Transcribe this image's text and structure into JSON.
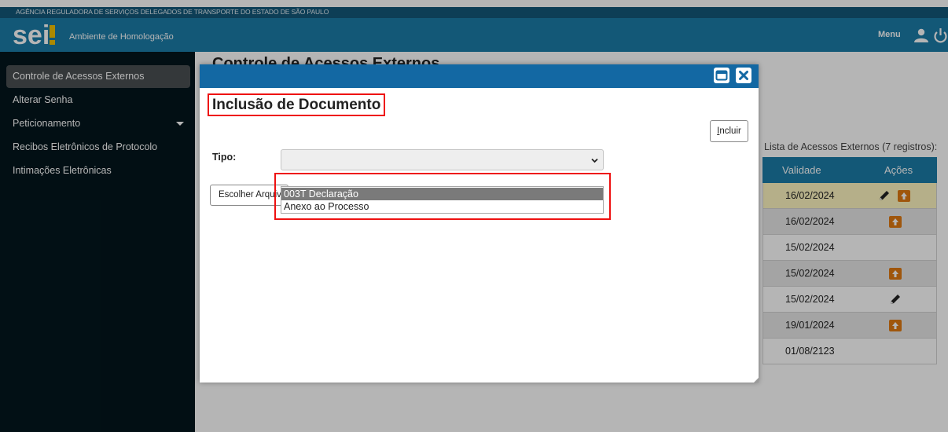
{
  "agency": {
    "name": "AGÊNCIA REGULADORA DE SERVIÇOS DELEGADOS DE TRANSPORTE DO ESTADO DE SÃO PAULO"
  },
  "header": {
    "logo_text": "sei!",
    "environment": "Ambiente de Homologação",
    "menu_label": "Menu",
    "icons": [
      "user-icon",
      "power-icon"
    ]
  },
  "sidebar": {
    "items": [
      {
        "label": "Controle de Acessos Externos",
        "active": true
      },
      {
        "label": "Alterar Senha"
      },
      {
        "label": "Peticionamento",
        "has_submenu": true
      },
      {
        "label": "Recibos Eletrônicos de Protocolo"
      },
      {
        "label": "Intimações Eletrônicas"
      }
    ]
  },
  "main": {
    "page_title": "Controle de Acessos Externos",
    "list_caption": "Lista de Acessos Externos (7 registros):",
    "table": {
      "columns": [
        "Validade",
        "Ações"
      ],
      "rows": [
        {
          "validade": "16/02/2024",
          "actions": [
            "pencil-icon",
            "upload-icon"
          ]
        },
        {
          "validade": "16/02/2024",
          "actions": [
            "upload-icon"
          ]
        },
        {
          "validade": "15/02/2024",
          "actions": []
        },
        {
          "validade": "15/02/2024",
          "actions": [
            "upload-icon"
          ]
        },
        {
          "validade": "15/02/2024",
          "actions": [
            "pencil-icon"
          ]
        },
        {
          "validade": "19/01/2024",
          "actions": [
            "upload-icon"
          ]
        },
        {
          "validade": "01/08/2123",
          "actions": []
        }
      ]
    }
  },
  "modal": {
    "title": "Inclusão de Documento",
    "incluir_label": "Incluir",
    "incluir_accesskey": "I",
    "incluir_rest": "ncluir",
    "tipo_label": "Tipo:",
    "tipo_value": "",
    "choose_file_label": "Escolher Arquivo",
    "options": [
      "003T Declaração",
      "Anexo ao Processo"
    ],
    "selected_option": "003T Declaração",
    "controls": [
      "minimize-icon",
      "close-icon"
    ]
  },
  "colors": {
    "header": "#1c7ca8",
    "agency_bar": "#13587a",
    "sidebar": "#03161d",
    "modal_bar": "#1368a3",
    "table_head": "#1c7ca8",
    "highlight_row": "#fff7c2",
    "upload_icon": "#e07a12",
    "annotation": "#ee1111"
  }
}
